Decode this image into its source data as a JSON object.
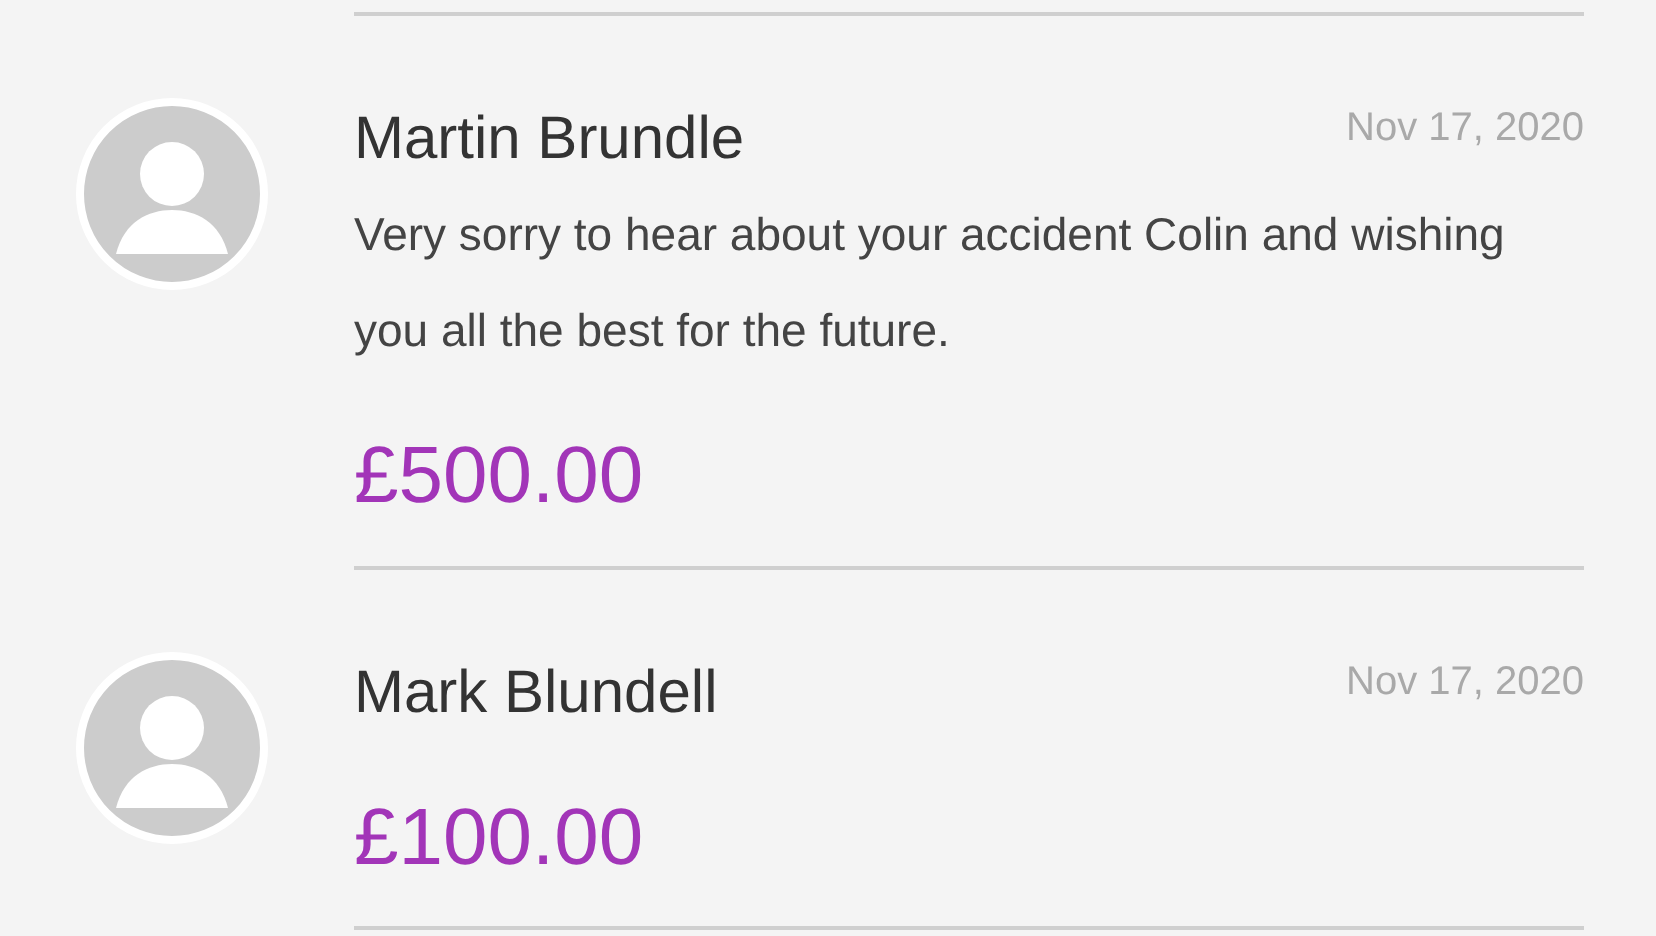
{
  "donations": [
    {
      "name": "Martin Brundle",
      "date": "Nov 17, 2020",
      "message": "Very sorry to hear about your accident Colin and wishing you all the best for the future.",
      "amount": "£500.00"
    },
    {
      "name": "Mark Blundell",
      "date": "Nov 17, 2020",
      "amount": "£100.00"
    }
  ]
}
